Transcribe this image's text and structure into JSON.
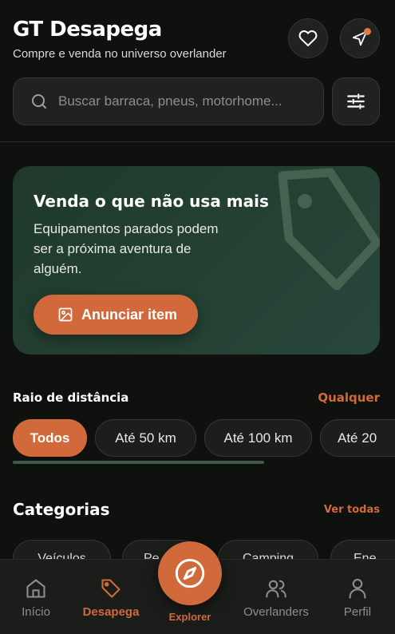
{
  "header": {
    "title": "GT Desapega",
    "subtitle": "Compre e venda no universo overlander",
    "favorite_icon": "heart-icon",
    "messages_icon": "send-icon"
  },
  "search": {
    "placeholder": "Buscar barraca, pneus, motorhome...",
    "filter_icon": "sliders-icon"
  },
  "promo": {
    "title": "Venda o que não usa mais",
    "text": "Equipamentos parados podem ser a próxima aventura de alguém.",
    "cta": "Anunciar item"
  },
  "distance": {
    "label": "Raio de distância",
    "value": "Qualquer",
    "chips": [
      "Todos",
      "Até 50 km",
      "Até 100 km",
      "Até 20"
    ],
    "selected": "Todos"
  },
  "categories": {
    "title": "Categorias",
    "link": "Ver todas",
    "items": [
      "Veículos",
      "Pe",
      "Camping",
      "Ene"
    ]
  },
  "tabbar": {
    "items": [
      {
        "label": "Início",
        "icon": "home-icon"
      },
      {
        "label": "Desapega",
        "icon": "tag-icon"
      },
      {
        "label": "Explorer",
        "icon": "compass-icon"
      },
      {
        "label": "Overlanders",
        "icon": "users-icon"
      },
      {
        "label": "Perfil",
        "icon": "user-icon"
      }
    ],
    "active": "Desapega"
  },
  "colors": {
    "accent": "#d2693a",
    "background": "#0e110e",
    "promo": "#28463a"
  }
}
